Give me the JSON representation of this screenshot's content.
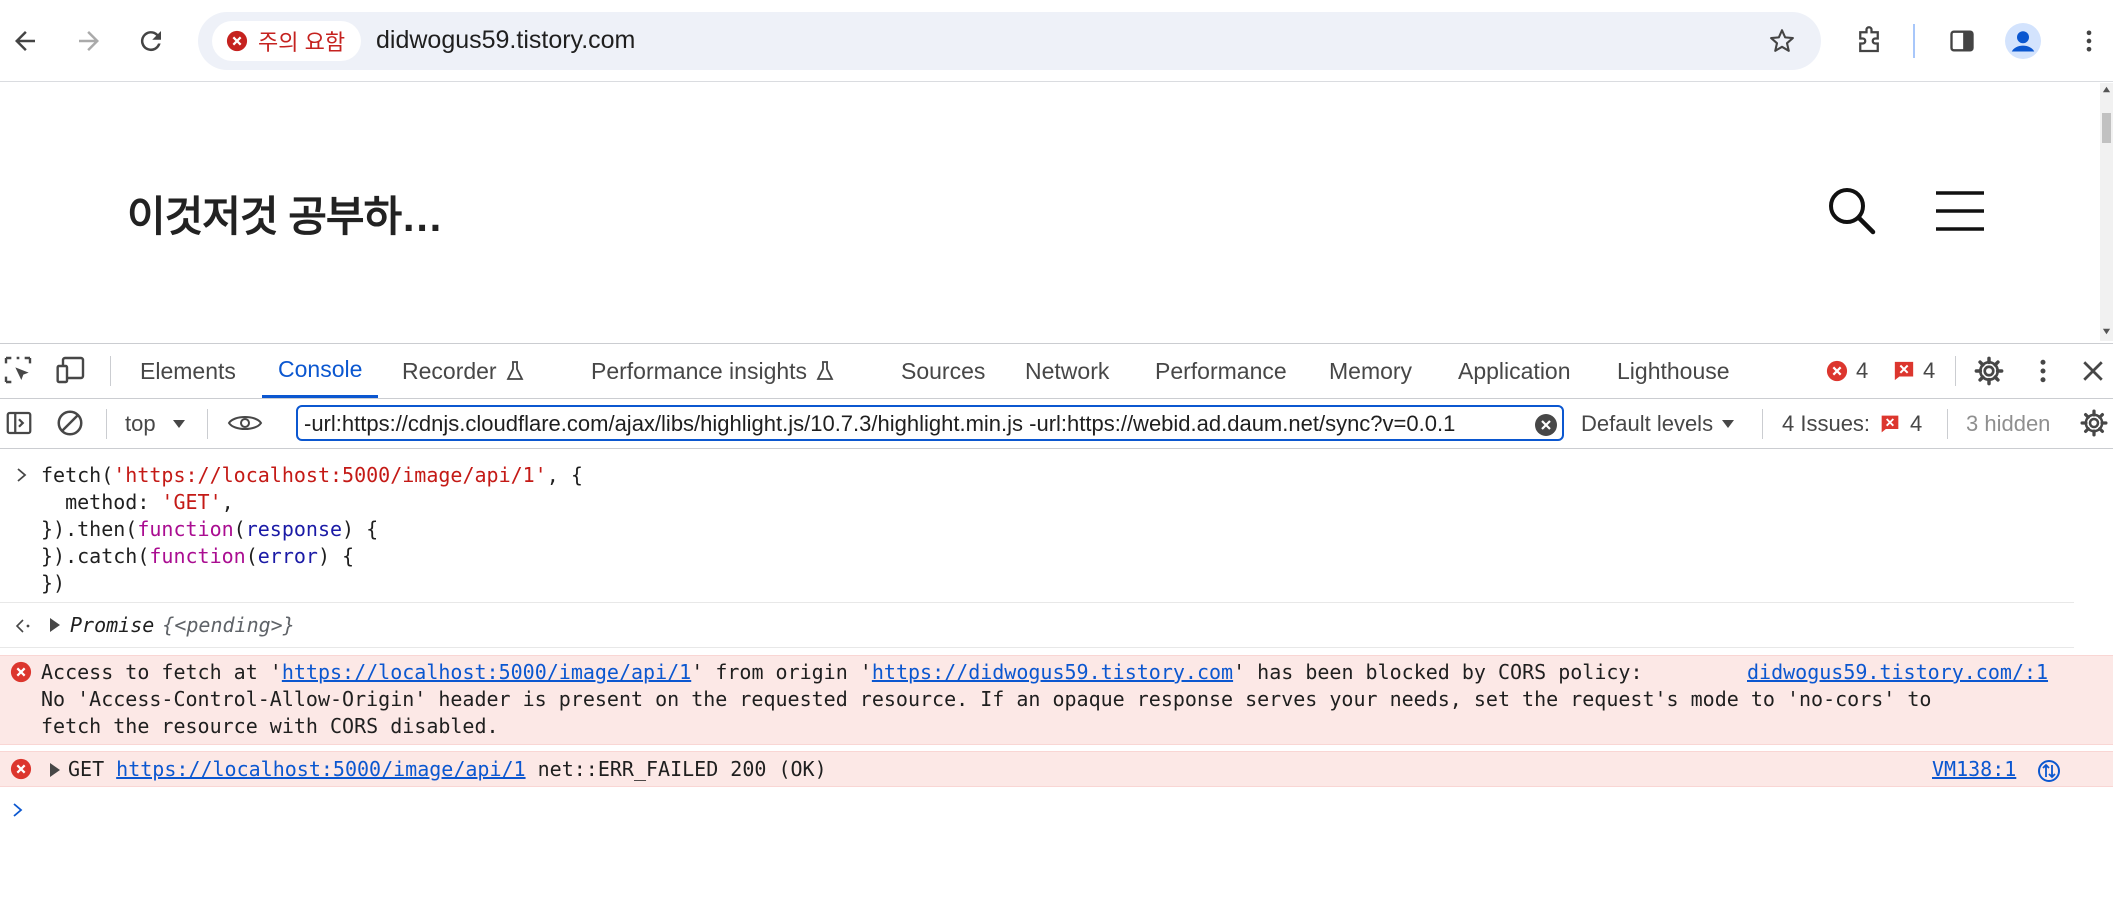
{
  "browser": {
    "security_chip": "주의 요함",
    "url": "didwogus59.tistory.com"
  },
  "page": {
    "blog_title": "이것저것 공부하…"
  },
  "devtools": {
    "tabs": [
      "Elements",
      "Console",
      "Recorder",
      "Performance insights",
      "Sources",
      "Network",
      "Performance",
      "Memory",
      "Application",
      "Lighthouse"
    ],
    "active_tab": "Console",
    "error_count": "4",
    "issue_count": "4",
    "context": "top",
    "filter_value": "-url:https://cdnjs.cloudflare.com/ajax/libs/highlight.js/10.7.3/highlight.min.js -url:https://webid.ad.daum.net/sync?v=0.0.1",
    "levels": "Default levels",
    "issues_label": "4 Issues:",
    "issues_count": "4",
    "hidden": "3 hidden"
  },
  "console": {
    "input": {
      "l1_a": "fetch(",
      "l1_str": "'https://localhost:5000/image/api/1'",
      "l1_b": ", {",
      "l2_a": "  method: ",
      "l2_str": "'GET'",
      "l2_b": ",",
      "l3_a": "}).then(",
      "l3_kw": "function",
      "l3_b": "(",
      "l3_var": "response",
      "l3_c": ") {",
      "l4_a": "}).catch(",
      "l4_kw": "function",
      "l4_b": "(",
      "l4_var": "error",
      "l4_c": ") {",
      "l5": "})"
    },
    "result": {
      "label": "Promise",
      "value": "{<pending>}"
    },
    "cors_error": {
      "pre": "Access to fetch at '",
      "url1": "https://localhost:5000/image/api/1",
      "mid": "' from origin '",
      "url2": "https://didwogus59.tistory.com",
      "post": "' has been blocked by CORS policy:",
      "source": "didwogus59.tistory.com/:1",
      "line2": "No 'Access-Control-Allow-Origin' header is present on the requested resource. If an opaque response serves your needs, set the request's mode to 'no-cors' to",
      "line3": "fetch the resource with CORS disabled."
    },
    "get_error": {
      "method": "GET",
      "url": "https://localhost:5000/image/api/1",
      "status": "net::ERR_FAILED 200 (OK)",
      "source": "VM138:1"
    }
  },
  "colors": {
    "accent": "#0b57d0",
    "error_bg": "#fce8e6",
    "error_icon": "#dc362e"
  }
}
